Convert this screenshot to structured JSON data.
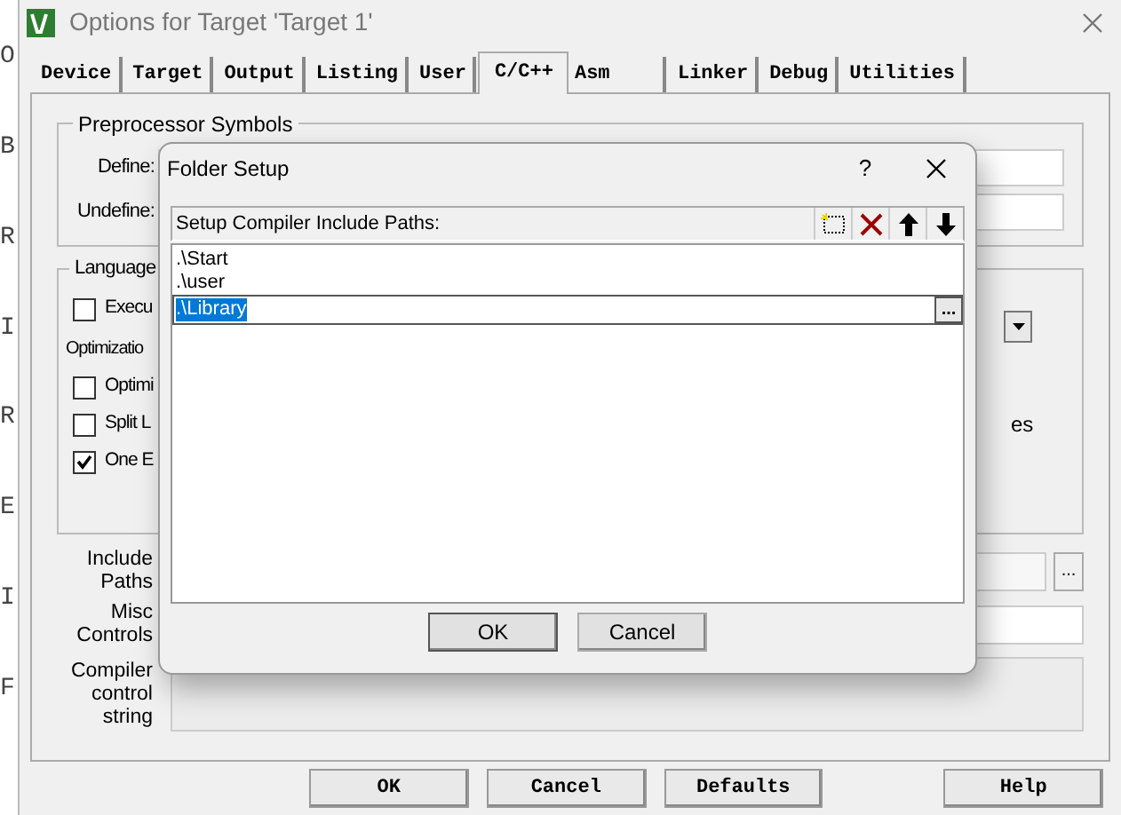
{
  "background_fragments": [
    "O",
    "B",
    "R",
    "I",
    "R",
    "E",
    "I",
    "F"
  ],
  "window": {
    "title": "Options for Target 'Target 1'"
  },
  "tabs": [
    {
      "label": "Device",
      "selected": false
    },
    {
      "label": "Target",
      "selected": false
    },
    {
      "label": "Output",
      "selected": false
    },
    {
      "label": "Listing",
      "selected": false
    },
    {
      "label": "User",
      "selected": false
    },
    {
      "label": "C/C++",
      "selected": true
    },
    {
      "label": "Asm",
      "selected": false
    },
    {
      "label": "Linker",
      "selected": false
    },
    {
      "label": "Debug",
      "selected": false
    },
    {
      "label": "Utilities",
      "selected": false
    }
  ],
  "preprocessor": {
    "title": "Preprocessor Symbols",
    "fields": [
      {
        "label": "Define:"
      },
      {
        "label": "Undefine:"
      }
    ]
  },
  "language": {
    "title": "Language",
    "items": [
      {
        "kind": "checkbox",
        "label": "Execu",
        "checked": false
      },
      {
        "kind": "label",
        "label": "Optimizatio"
      },
      {
        "kind": "checkbox",
        "label": "Optimi",
        "checked": false
      },
      {
        "kind": "checkbox",
        "label": "Split L",
        "checked": false
      },
      {
        "kind": "checkbox",
        "label": "One E",
        "checked": true
      }
    ],
    "right_text": "es"
  },
  "include_paths": {
    "label": "Include Paths",
    "browse": "..."
  },
  "misc_controls": {
    "label": "Misc Controls"
  },
  "compiler_string": {
    "label": "Compiler control string"
  },
  "buttons": [
    "OK",
    "Cancel",
    "Defaults",
    "Help"
  ],
  "dialog": {
    "title": "Folder Setup",
    "help": "?",
    "header": "Setup Compiler Include Paths:",
    "paths": [
      {
        "text": ".\\Start",
        "selected": false
      },
      {
        "text": ".\\user",
        "selected": false
      },
      {
        "text": ".\\Library",
        "selected": true
      }
    ],
    "browse": "...",
    "buttons": [
      "OK",
      "Cancel"
    ]
  }
}
